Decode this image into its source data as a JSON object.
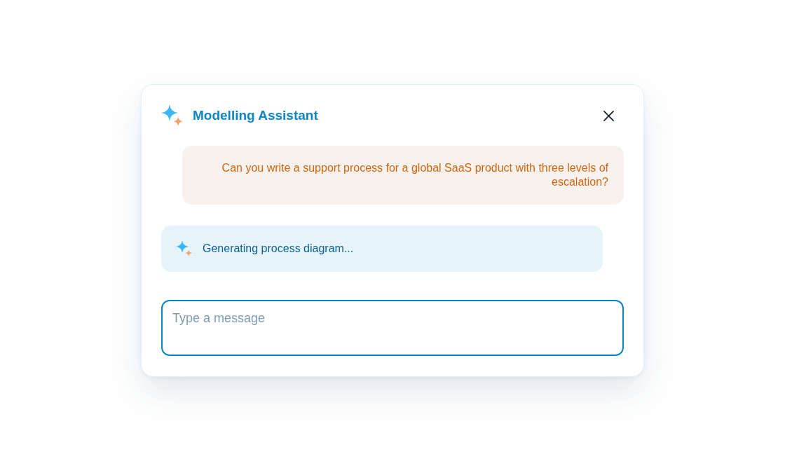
{
  "assistant": {
    "title": "Modelling Assistant"
  },
  "messages": [
    {
      "kind": "user",
      "text": "Can you write a support process for a global SaaS product with three levels of escalation?"
    },
    {
      "kind": "status",
      "text": "Generating process diagram..."
    }
  ],
  "composer": {
    "placeholder": "Type a message"
  }
}
